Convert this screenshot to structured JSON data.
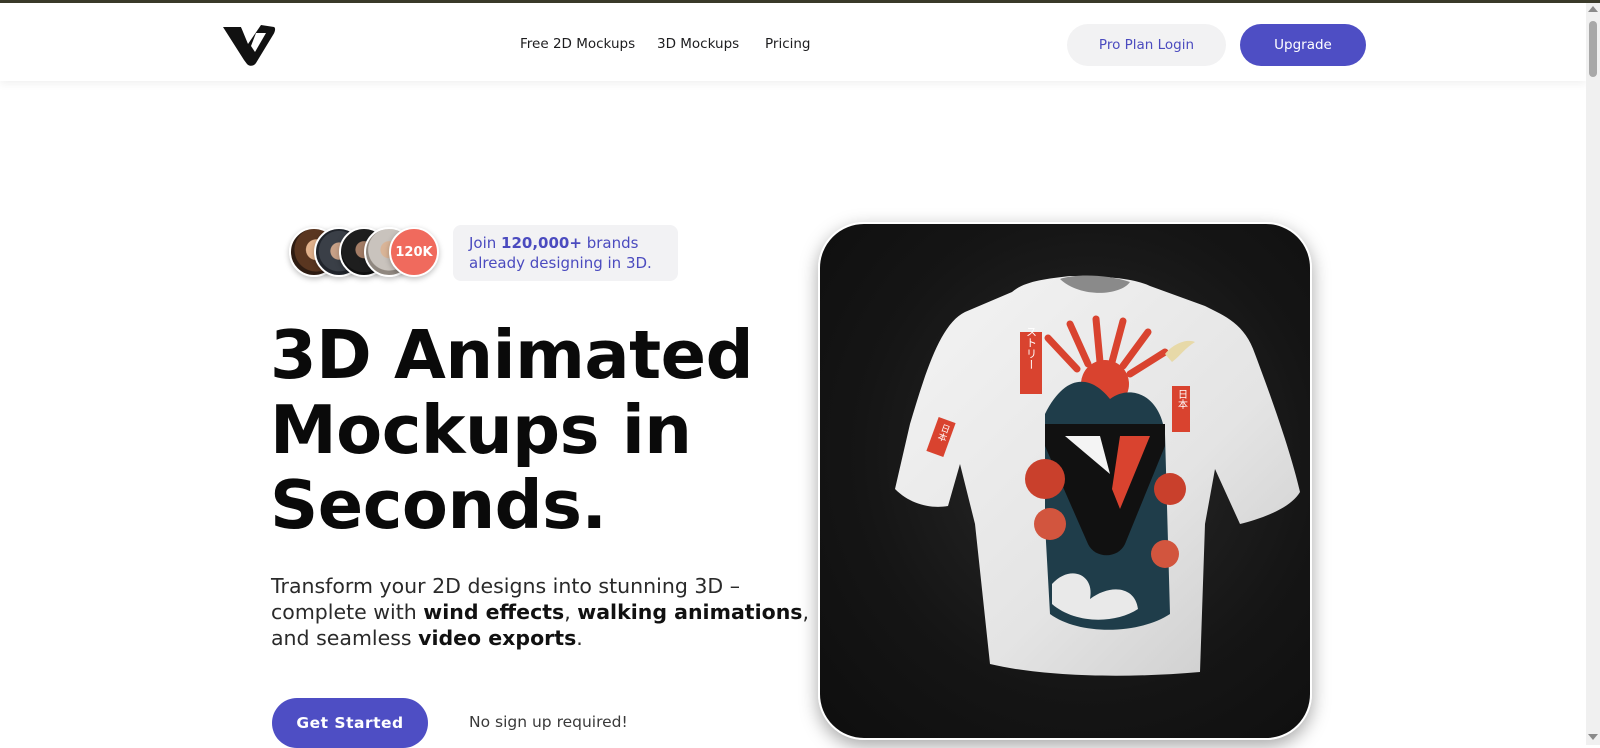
{
  "header": {
    "nav": [
      "Free 2D Mockups",
      "3D Mockups",
      "Pricing"
    ],
    "login_label": "Pro Plan Login",
    "upgrade_label": "Upgrade"
  },
  "social_proof": {
    "avatar_count_badge": "120K",
    "join_prefix": "Join ",
    "join_count": "120,000+",
    "join_suffix": " brands",
    "join_line2": "already designing in 3D."
  },
  "hero": {
    "title_lines": [
      "3D Animated",
      "Mockups in",
      "Seconds."
    ],
    "desc_line1": "Transform your 2D designs into stunning 3D –",
    "desc_line2_prefix": "complete with ",
    "desc_wind": "wind effects",
    "desc_comma1": ", ",
    "desc_walking": "walking animations",
    "desc_comma2": ",",
    "desc_line3_prefix": "and seamless ",
    "desc_video": "video exports",
    "desc_period": ".",
    "cta_label": "Get Started",
    "no_signup": "No sign up required!"
  },
  "media": {
    "sleeve_text_left": "ストリー",
    "sleeve_text_right": "日本",
    "sleeve_text_arm": "日本"
  },
  "colors": {
    "accent": "#4e4ec4",
    "badge": "#f06a5d",
    "dark_panel": "#151515"
  },
  "icons": [
    "brand-logo-icon",
    "tshirt-mockup-image"
  ]
}
